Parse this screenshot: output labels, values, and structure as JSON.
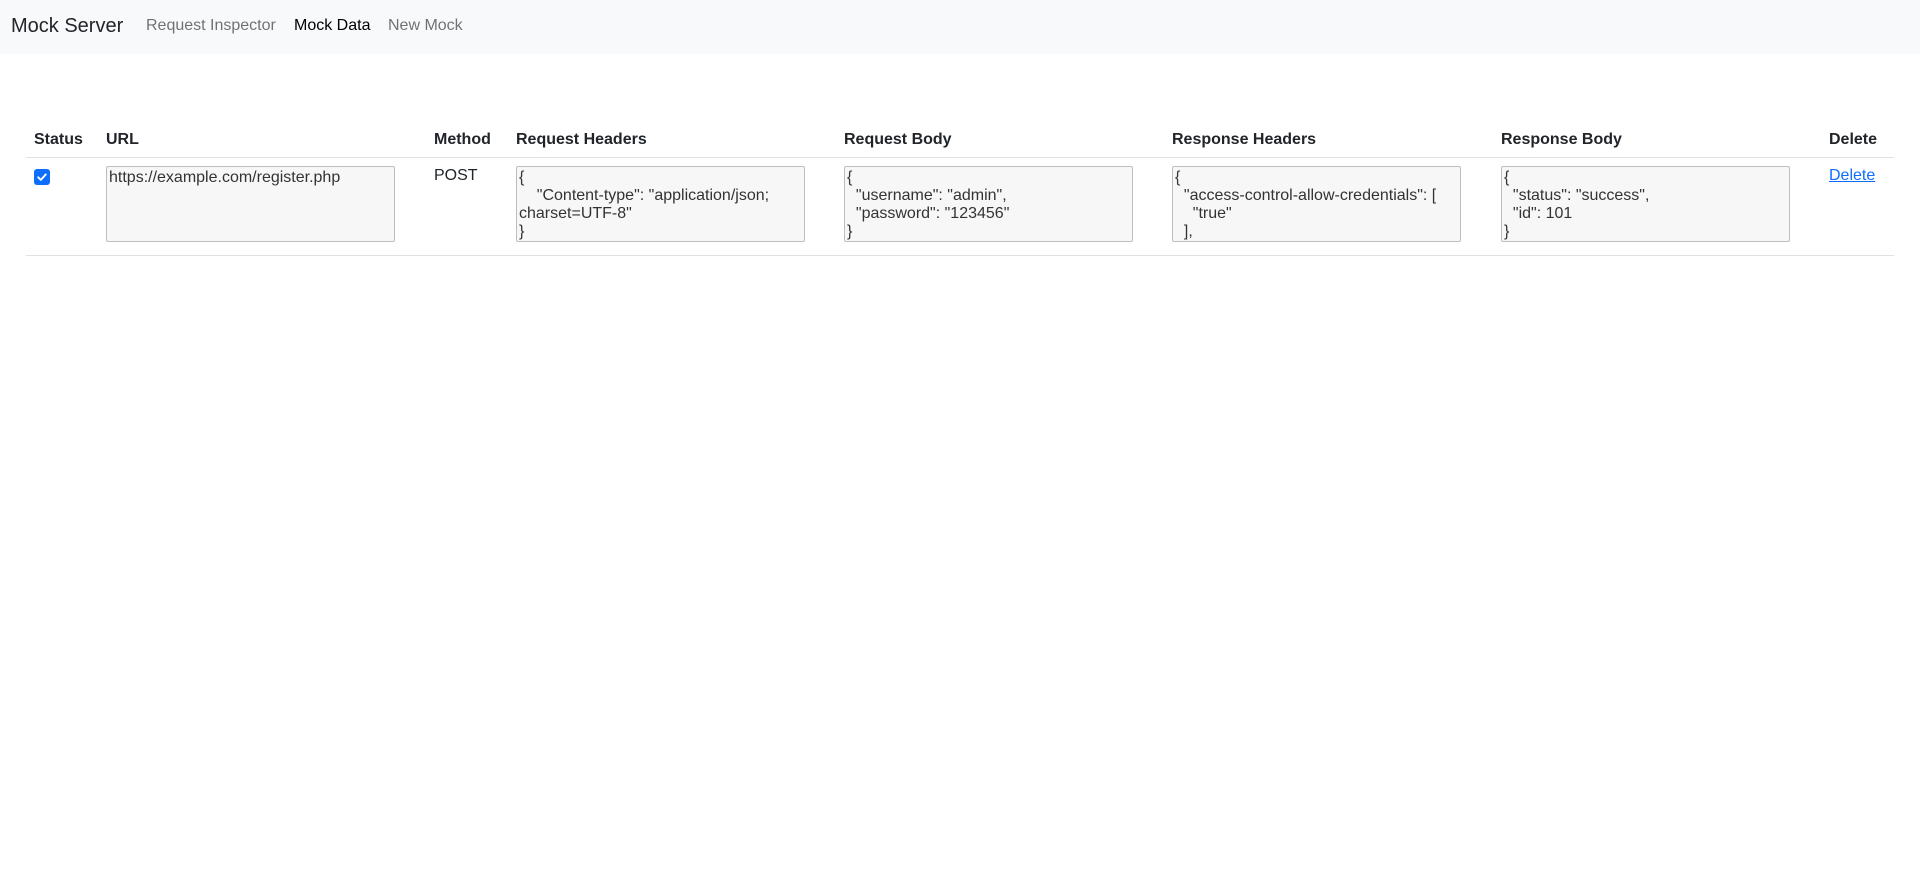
{
  "navbar": {
    "brand": "Mock Server",
    "links": [
      {
        "label": "Request Inspector",
        "active": false
      },
      {
        "label": "Mock Data",
        "active": true
      },
      {
        "label": "New Mock",
        "active": false
      }
    ]
  },
  "table": {
    "headers": [
      "Status",
      "URL",
      "Method",
      "Request Headers",
      "Request Body",
      "Response Headers",
      "Response Body",
      "Delete"
    ],
    "rows": [
      {
        "status_checked": true,
        "url": "https://example.com/register.php",
        "method": "POST",
        "request_headers": "{\n    \"Content-type\": \"application/json; charset=UTF-8\"\n}",
        "request_body": "{\n  \"username\": \"admin\",\n  \"password\": \"123456\"\n}",
        "response_headers": "{\n  \"access-control-allow-credentials\": [\n    \"true\"\n  ],",
        "response_body": "{\n  \"status\": \"success\",\n  \"id\": 101\n}",
        "delete_label": "Delete"
      }
    ]
  },
  "colors": {
    "navbar_bg": "#f8f9fa",
    "accent": "#0d6efd",
    "textarea_bg": "#f7f7f7"
  }
}
